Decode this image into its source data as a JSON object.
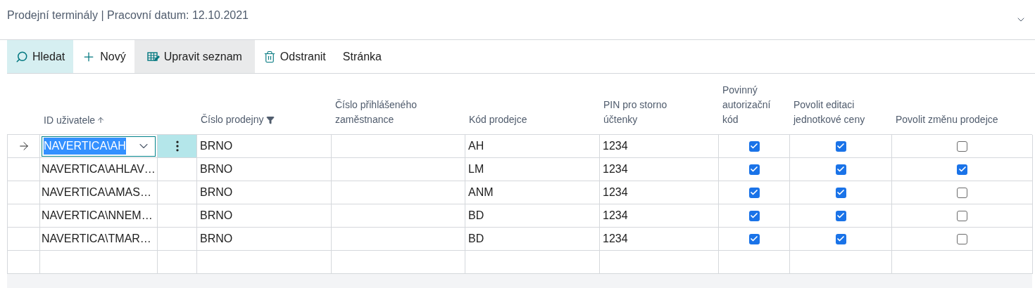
{
  "page": {
    "title": "Prodejní terminály | Pracovní datum: 12.10.2021"
  },
  "toolbar": [
    {
      "kind": "search",
      "label": "Hledat",
      "selected": true,
      "hovered": false
    },
    {
      "kind": "new",
      "label": "Nový",
      "selected": false,
      "hovered": false
    },
    {
      "kind": "edit",
      "label": "Upravit seznam",
      "selected": false,
      "hovered": true
    },
    {
      "kind": "delete",
      "label": "Odstranit",
      "selected": false,
      "hovered": false
    },
    {
      "kind": "plain",
      "label": "Stránka",
      "selected": false,
      "hovered": false
    }
  ],
  "table": {
    "columns": [
      {
        "label": "ID uživatele",
        "sorted": true,
        "filtered": false
      },
      {
        "label": "Číslo prodejny",
        "sorted": false,
        "filtered": true
      },
      {
        "label": "Číslo přihlášeného zaměstnance",
        "sorted": false,
        "filtered": false
      },
      {
        "label": "Kód prodejce",
        "sorted": false,
        "filtered": false
      },
      {
        "label": "PIN pro storno účtenky",
        "sorted": false,
        "filtered": false
      },
      {
        "label": "Povinný autorizační kód",
        "sorted": false,
        "filtered": false
      },
      {
        "label": "Povolit editaci jednotkové ceny",
        "sorted": false,
        "filtered": false
      },
      {
        "label": "Povolit změnu prodejce",
        "sorted": false,
        "filtered": false
      }
    ],
    "rows": [
      {
        "selected": true,
        "user_id": "NAVERTICA\\AH",
        "store": "BRNO",
        "code": "AH",
        "pin": "1234",
        "auth_required": true,
        "edit_price": true,
        "change_seller": false
      },
      {
        "selected": false,
        "user_id": "NAVERTICA\\AHLAV…",
        "store": "BRNO",
        "code": "LM",
        "pin": "1234",
        "auth_required": true,
        "edit_price": true,
        "change_seller": true
      },
      {
        "selected": false,
        "user_id": "NAVERTICA\\AMAS…",
        "store": "BRNO",
        "code": "ANM",
        "pin": "1234",
        "auth_required": true,
        "edit_price": true,
        "change_seller": false
      },
      {
        "selected": false,
        "user_id": "NAVERTICA\\NNEM…",
        "store": "BRNO",
        "code": "BD",
        "pin": "1234",
        "auth_required": true,
        "edit_price": true,
        "change_seller": false
      },
      {
        "selected": false,
        "user_id": "NAVERTICA\\TMAR…",
        "store": "BRNO",
        "code": "BD",
        "pin": "1234",
        "auth_required": true,
        "edit_price": true,
        "change_seller": false
      }
    ]
  }
}
